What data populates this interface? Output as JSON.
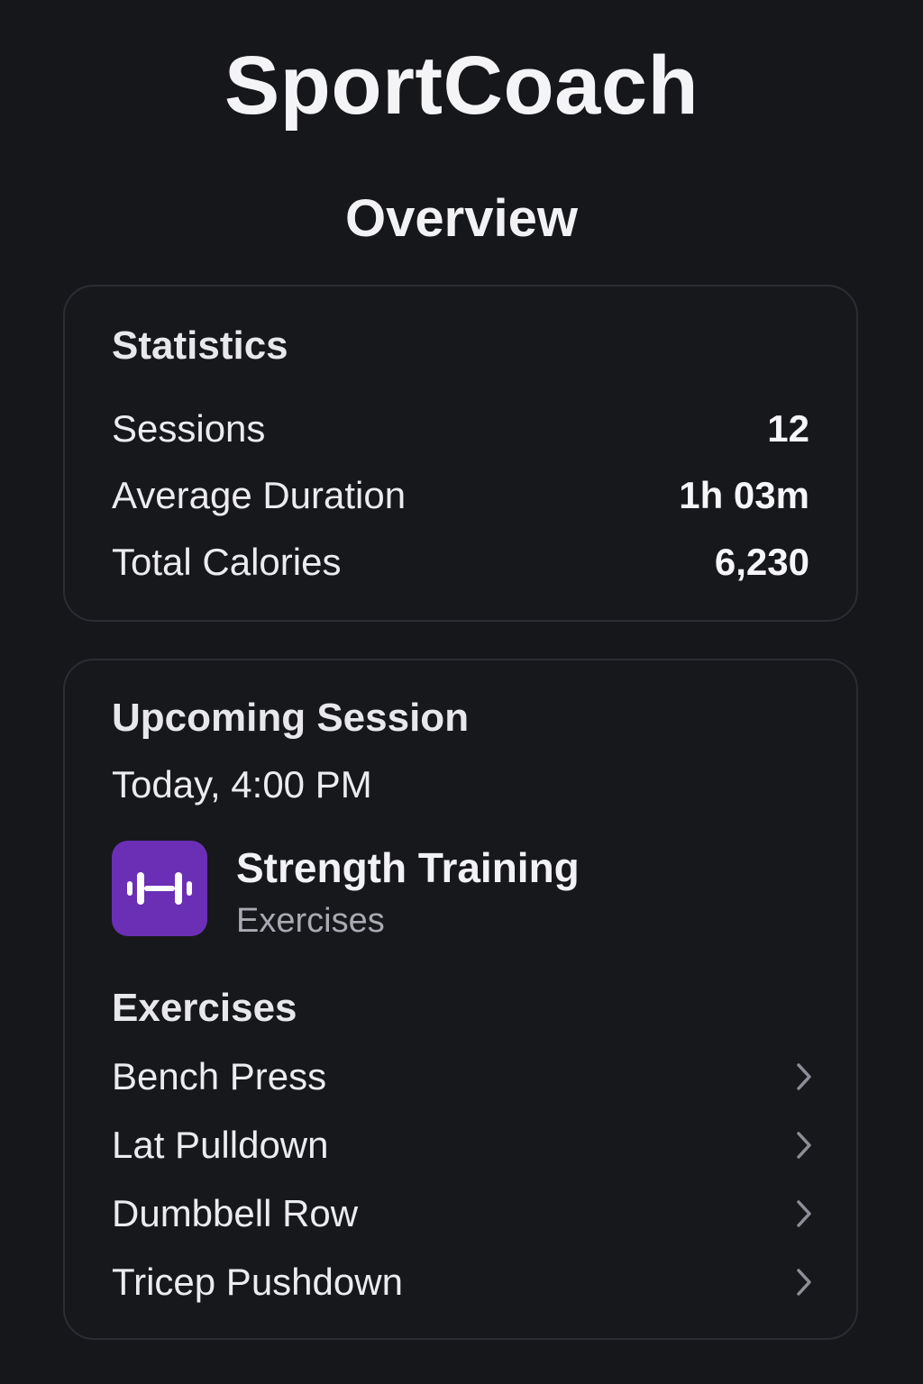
{
  "app": {
    "title": "SportCoach"
  },
  "page": {
    "title": "Overview"
  },
  "statistics": {
    "heading": "Statistics",
    "rows": [
      {
        "label": "Sessions",
        "value": "12"
      },
      {
        "label": "Average Duration",
        "value": "1h 03m"
      },
      {
        "label": "Total Calories",
        "value": "6,230"
      }
    ]
  },
  "upcoming": {
    "heading": "Upcoming Session",
    "time": "Today, 4:00 PM",
    "workout": {
      "name": "Strength Training",
      "subtitle": "Exercises",
      "icon": "dumbbell-icon",
      "icon_bg": "#6b2fb5"
    },
    "exercises_heading": "Exercises",
    "exercises": [
      {
        "label": "Bench Press"
      },
      {
        "label": "Lat Pulldown"
      },
      {
        "label": "Dumbbell Row"
      },
      {
        "label": "Tricep Pushdown"
      }
    ]
  }
}
